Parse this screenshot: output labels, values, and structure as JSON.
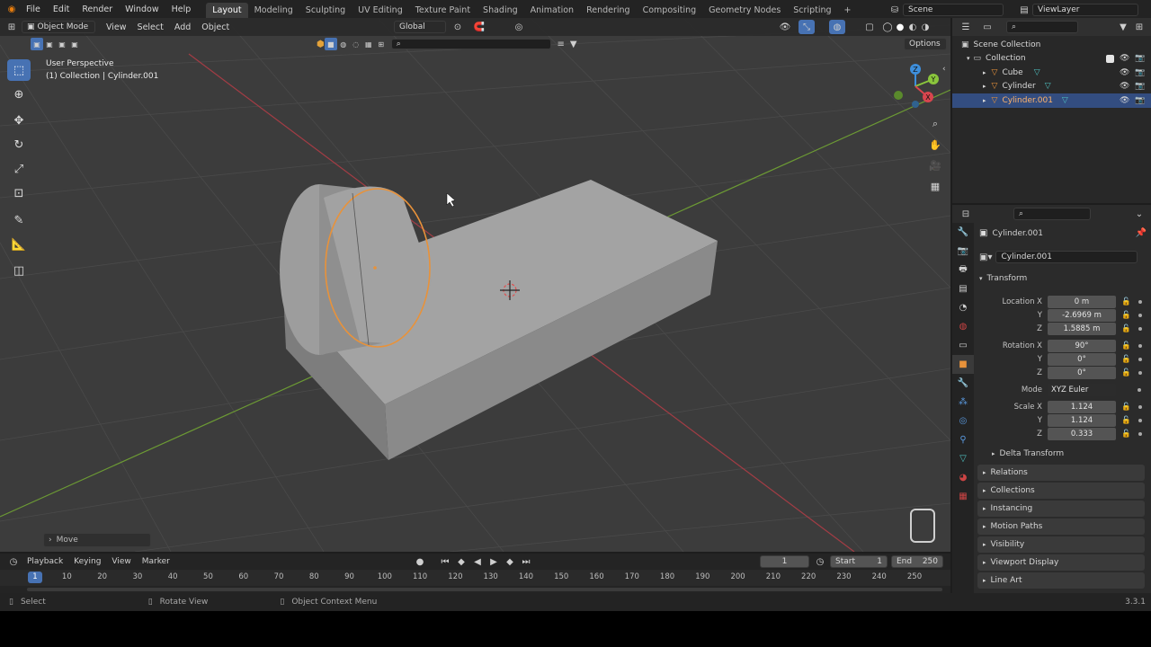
{
  "topbar": {
    "menus": [
      "File",
      "Edit",
      "Render",
      "Window",
      "Help"
    ],
    "workspaces": [
      "Layout",
      "Modeling",
      "Sculpting",
      "UV Editing",
      "Texture Paint",
      "Shading",
      "Animation",
      "Rendering",
      "Compositing",
      "Geometry Nodes",
      "Scripting"
    ],
    "active_workspace": "Layout",
    "add_tab": "+",
    "scene": "Scene",
    "view_layer": "ViewLayer"
  },
  "viewport": {
    "mode": "Object Mode",
    "menus": [
      "View",
      "Select",
      "Add",
      "Object"
    ],
    "orientation": "Global",
    "options_label": "Options",
    "overlay_title": "User Perspective",
    "overlay_subtitle": "(1) Collection | Cylinder.001",
    "last_operator": "Move",
    "axis_x": "X",
    "axis_y": "Y",
    "axis_z": "Z"
  },
  "outliner": {
    "items": [
      {
        "label": "Scene Collection",
        "indent": 0
      },
      {
        "label": "Collection",
        "indent": 1
      },
      {
        "label": "Cube",
        "indent": 2
      },
      {
        "label": "Cylinder",
        "indent": 2
      },
      {
        "label": "Cylinder.001",
        "indent": 2,
        "selected": true
      }
    ]
  },
  "properties": {
    "object_name": "Cylinder.001",
    "data_name": "Cylinder.001",
    "transform_label": "Transform",
    "location_label": "Location X",
    "location": {
      "x": "0 m",
      "y": "-2.6969 m",
      "z": "1.5885 m"
    },
    "rotation_label": "Rotation X",
    "rotation": {
      "x": "90°",
      "y": "0°",
      "z": "0°"
    },
    "mode_label": "Mode",
    "mode_value": "XYZ Euler",
    "scale_label": "Scale X",
    "scale": {
      "x": "1.124",
      "y": "1.124",
      "z": "0.333"
    },
    "y_label": "Y",
    "z_label": "Z",
    "delta_transform": "Delta Transform",
    "panels": [
      "Relations",
      "Collections",
      "Instancing",
      "Motion Paths",
      "Visibility",
      "Viewport Display",
      "Line Art"
    ]
  },
  "timeline": {
    "menus": [
      "Playback",
      "Keying",
      "View",
      "Marker"
    ],
    "current_frame": "1",
    "start_label": "Start",
    "start": "1",
    "end_label": "End",
    "end": "250",
    "ticks": [
      "1",
      "10",
      "20",
      "30",
      "40",
      "50",
      "60",
      "70",
      "80",
      "90",
      "100",
      "110",
      "120",
      "130",
      "140",
      "150",
      "160",
      "170",
      "180",
      "190",
      "200",
      "210",
      "220",
      "230",
      "240",
      "250"
    ]
  },
  "status": {
    "select": "Select",
    "rotate": "Rotate View",
    "context": "Object Context Menu",
    "version": "3.3.1"
  },
  "colors": {
    "accent": "#4772b3",
    "selection_outline": "#e8923a",
    "x_axis": "#d8454e",
    "y_axis": "#8ac53c",
    "z_axis": "#3e8fdc"
  }
}
